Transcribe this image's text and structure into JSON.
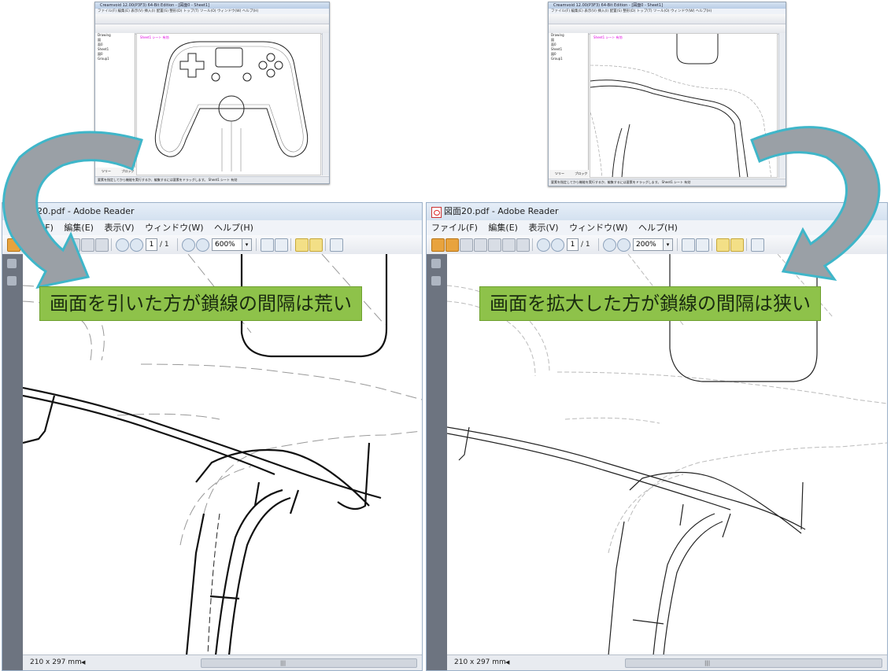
{
  "thumb_left": {
    "title": "Creamvoid 12.00(P3F3) 64-Bit Edition - [図面0 - Sheet1]",
    "menu": "ファイル(F)  編集(E)  表示(V)  挿入(I)  配置(S)  整形(D)  トップ(T)  ツール(O)  ウィンドウ(W)  ヘルプ(H)",
    "tree": [
      "Drawing",
      "図",
      "面0",
      "Sheet1",
      "図0",
      "Group1"
    ],
    "sheet_label": "Sheet1 シート 有効",
    "tabs": [
      "ツリー",
      "ブロック"
    ],
    "status": "要素を指定してから機能を実行するか、編集するには要素をドラッグします。          Sheet1 シート 有効"
  },
  "thumb_right": {
    "title": "Creamvoid 12.00(P3F3) 64-Bit Edition - [図面0 - Sheet1]",
    "menu": "ファイル(F)  編集(E)  表示(V)  挿入(I)  配置(S)  整形(D)  トップ(T)  ツール(O)  ウィンドウ(W)  ヘルプ(H)",
    "tree": [
      "Drawing",
      "図",
      "面0",
      "Sheet1",
      "図0",
      "Group1"
    ],
    "sheet_label": "Sheet1 シート 有効",
    "tabs": [
      "ツリー",
      "ブロック"
    ],
    "status": "要素を指定してから機能を実行するか、編集するには要素をドラッグします。          Sheet1 シート 有効"
  },
  "reader_left": {
    "title": "図面20.pdf - Adobe Reader",
    "menu": [
      "ファイル(F)",
      "編集(E)",
      "表示(V)",
      "ウィンドウ(W)",
      "ヘルプ(H)"
    ],
    "page_current": "1",
    "page_total": "/ 1",
    "zoom": "600%",
    "page_size": "210 x 297 mm",
    "callout": "画面を引いた方が鎖線の間隔は荒い"
  },
  "reader_right": {
    "title": "図面20.pdf - Adobe Reader",
    "menu": [
      "ファイル(F)",
      "編集(E)",
      "表示(V)",
      "ウィンドウ(W)",
      "ヘルプ(H)"
    ],
    "page_current": "1",
    "page_total": "/ 1",
    "zoom": "200%",
    "page_size": "210 x 297 mm",
    "callout": "画面を拡大した方が鎖線の間隔は狭い"
  },
  "colors": {
    "callout_bg": "#8ec24a",
    "arrow_fill": "#9aa0a6",
    "arrow_stroke": "#3fb6c9"
  }
}
